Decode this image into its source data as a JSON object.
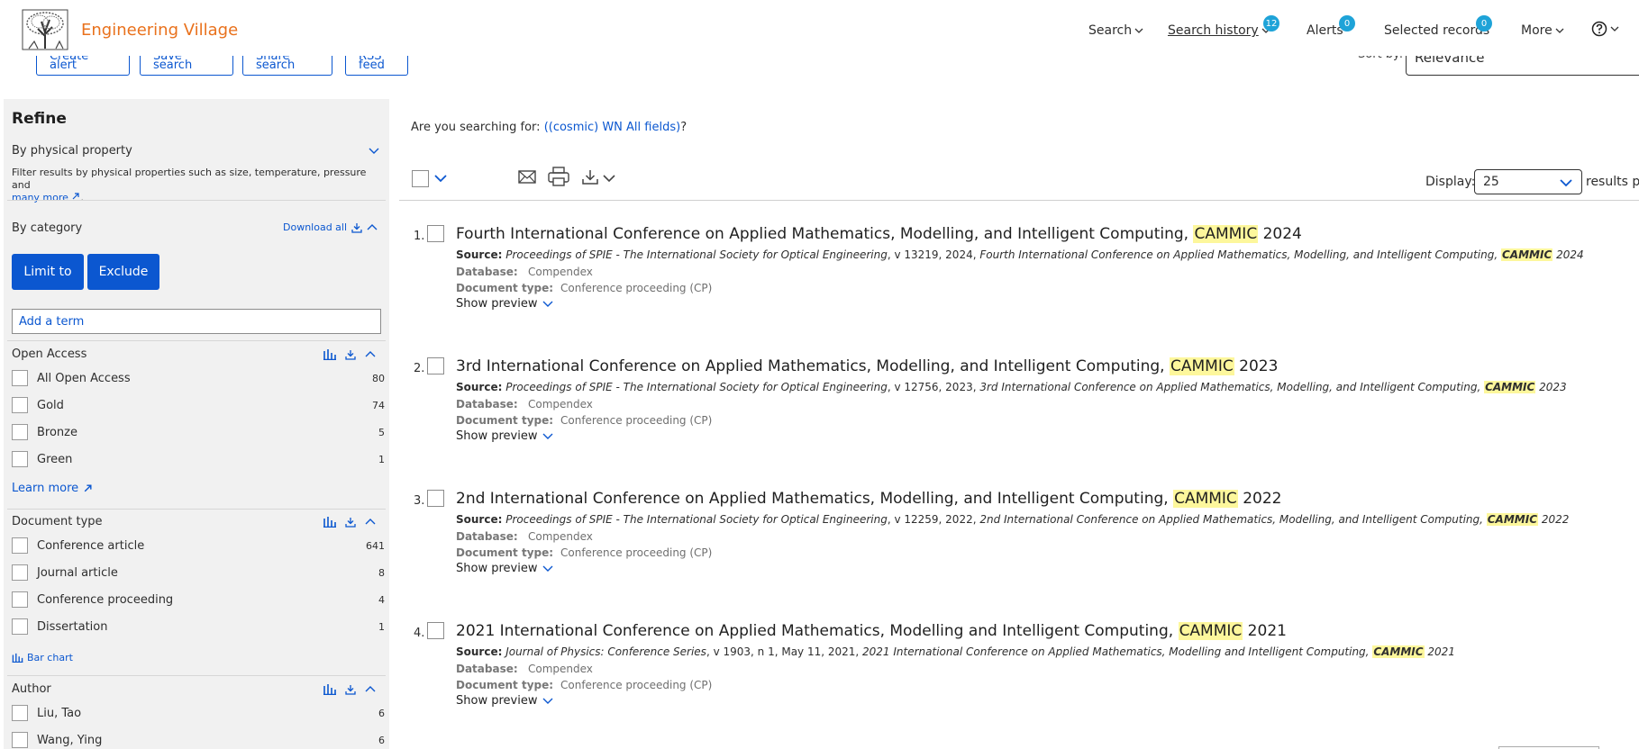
{
  "header": {
    "brand": "Engineering Village",
    "nav": {
      "search": "Search",
      "search_history": "Search history",
      "search_history_count": "12",
      "alerts": "Alerts",
      "alerts_count": "0",
      "selected_records": "Selected records",
      "selected_records_count": "0",
      "more": "More"
    }
  },
  "actions": {
    "create_alert": "Create alert",
    "save_search": "Save search",
    "share_search": "Share search",
    "rss_feed": "RSS feed",
    "sort_by_label": "Sort by:",
    "sort_by_value": "Relevance"
  },
  "sidebar": {
    "title": "Refine",
    "physical_property": {
      "label": "By physical property",
      "desc": "Filter results by physical properties such as size, temperature, pressure and",
      "more_link": "many more"
    },
    "category": {
      "label": "By category",
      "download_all": "Download all",
      "limit_to": "Limit to",
      "exclude": "Exclude",
      "add_term_placeholder": "Add a term"
    },
    "open_access": {
      "label": "Open Access",
      "items": [
        {
          "label": "All Open Access",
          "count": "80"
        },
        {
          "label": "Gold",
          "count": "74"
        },
        {
          "label": "Bronze",
          "count": "5"
        },
        {
          "label": "Green",
          "count": "1"
        }
      ],
      "learn_more": "Learn more"
    },
    "document_type": {
      "label": "Document type",
      "items": [
        {
          "label": "Conference article",
          "count": "641"
        },
        {
          "label": "Journal article",
          "count": "8"
        },
        {
          "label": "Conference proceeding",
          "count": "4"
        },
        {
          "label": "Dissertation",
          "count": "1"
        }
      ],
      "bar_chart": "Bar chart"
    },
    "author": {
      "label": "Author",
      "items": [
        {
          "label": "Liu, Tao",
          "count": "6"
        },
        {
          "label": "Wang, Ying",
          "count": "6"
        }
      ]
    }
  },
  "main": {
    "spell_prefix": "Are you searching for: ",
    "spell_link": "((cosmic) WN All fields)",
    "spell_suffix": "?",
    "display_label": "Display:",
    "display_value": "25",
    "results_per": "results pe",
    "results": [
      {
        "num": "1.",
        "title_pre": "Fourth International Conference on Applied Mathematics, Modelling, and Intelligent Computing, ",
        "title_hl": "CAMMIC",
        "title_post": " 2024",
        "source_label": "Source:",
        "source_journal": "Proceedings of SPIE - The International Society for Optical Engineering",
        "source_mid": ", v 13219, 2024, ",
        "source_conf": "Fourth International Conference on Applied Mathematics, Modelling, and Intelligent Computing, ",
        "source_hl": "CAMMIC",
        "source_year": " 2024",
        "database_label": "Database:",
        "database": "Compendex",
        "doctype_label": "Document type:",
        "doctype": "Conference proceeding (CP)",
        "preview": "Show preview"
      },
      {
        "num": "2.",
        "title_pre": "3rd International Conference on Applied Mathematics, Modelling, and Intelligent Computing, ",
        "title_hl": "CAMMIC",
        "title_post": " 2023",
        "source_label": "Source:",
        "source_journal": "Proceedings of SPIE - The International Society for Optical Engineering",
        "source_mid": ", v 12756, 2023, ",
        "source_conf": "3rd International Conference on Applied Mathematics, Modelling, and Intelligent Computing, ",
        "source_hl": "CAMMIC",
        "source_year": " 2023",
        "database_label": "Database:",
        "database": "Compendex",
        "doctype_label": "Document type:",
        "doctype": "Conference proceeding (CP)",
        "preview": "Show preview"
      },
      {
        "num": "3.",
        "title_pre": "2nd International Conference on Applied Mathematics, Modelling, and Intelligent Computing, ",
        "title_hl": "CAMMIC",
        "title_post": " 2022",
        "source_label": "Source:",
        "source_journal": "Proceedings of SPIE - The International Society for Optical Engineering",
        "source_mid": ", v 12259, 2022, ",
        "source_conf": "2nd International Conference on Applied Mathematics, Modelling, and Intelligent Computing, ",
        "source_hl": "CAMMIC",
        "source_year": " 2022",
        "database_label": "Database:",
        "database": "Compendex",
        "doctype_label": "Document type:",
        "doctype": "Conference proceeding (CP)",
        "preview": "Show preview"
      },
      {
        "num": "4.",
        "title_pre": "2021 International Conference on Applied Mathematics, Modelling and Intelligent Computing, ",
        "title_hl": "CAMMIC",
        "title_post": " 2021",
        "source_label": "Source:",
        "source_journal": "Journal of Physics: Conference Series",
        "source_mid": ", v 1903, n 1, May 11, 2021, ",
        "source_conf": "2021 International Conference on Applied Mathematics, Modelling and Intelligent Computing, ",
        "source_hl": "CAMMIC",
        "source_year": " 2021",
        "database_label": "Database:",
        "database": "Compendex",
        "doctype_label": "Document type:",
        "doctype": "Conference proceeding (CP)",
        "preview": "Show preview"
      }
    ]
  },
  "icons": {
    "logo": "elsevier-tree-logo",
    "email": "email-icon",
    "print": "print-icon",
    "download": "download-icon",
    "help": "help-icon",
    "bar_chart": "bar-chart-icon",
    "external": "external-link-icon"
  },
  "colors": {
    "brand": "#e9711c",
    "primary": "#0b57d0",
    "badge": "#1ea3d8",
    "highlight": "#fdf79c",
    "sidebar_bg": "#f1f1f1"
  }
}
